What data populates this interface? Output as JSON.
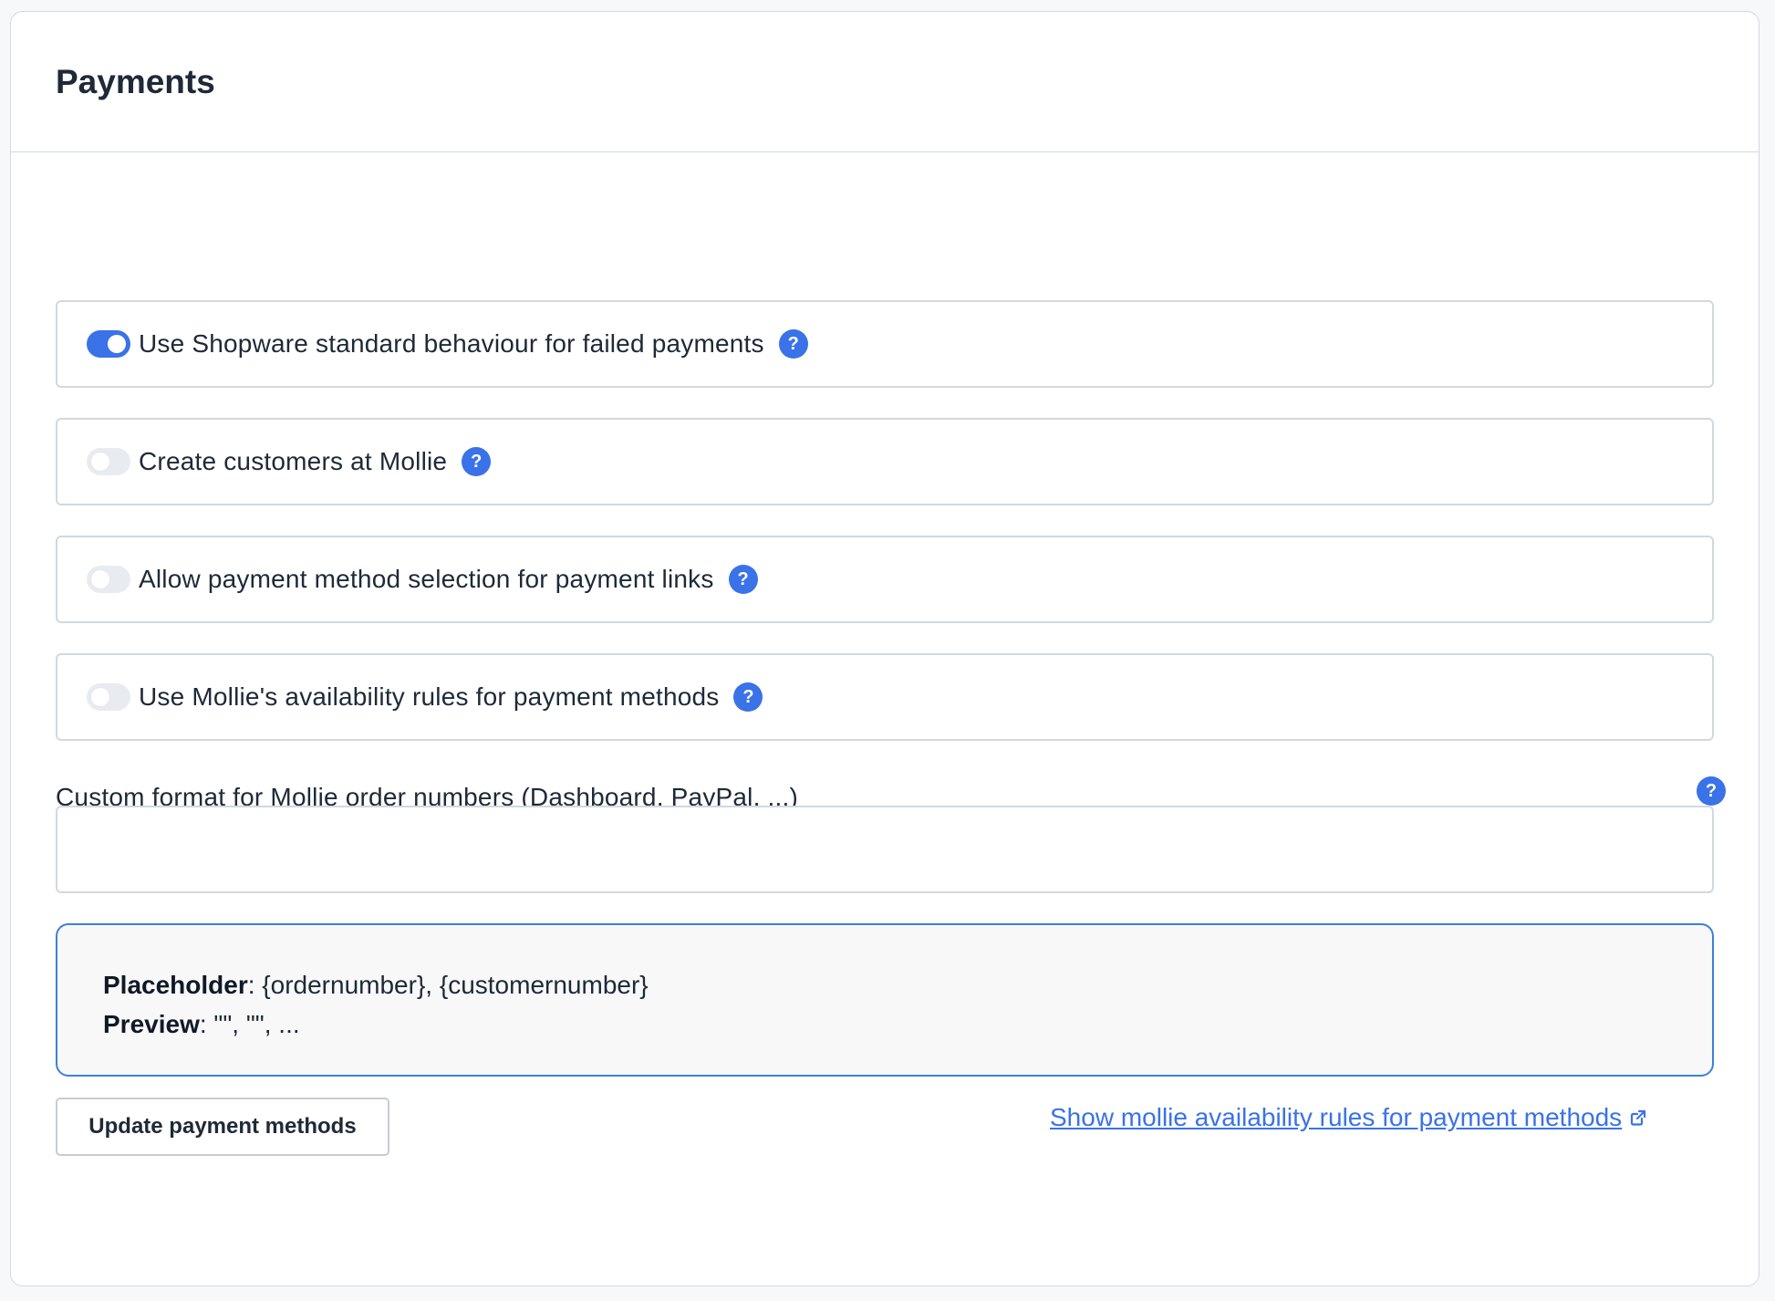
{
  "card": {
    "title": "Payments"
  },
  "switches": [
    {
      "label": "Use Shopware standard behaviour for failed payments",
      "checked": true
    },
    {
      "label": "Create customers at Mollie",
      "checked": false
    },
    {
      "label": "Allow payment method selection for payment links",
      "checked": false
    },
    {
      "label": "Use Mollie's availability rules for payment methods",
      "checked": false
    }
  ],
  "help_glyph": "?",
  "order_format": {
    "label": "Custom format for Mollie order numbers (Dashboard, PayPal, ...)",
    "value": "",
    "placeholder": ""
  },
  "info": {
    "placeholder_label": "Placeholder",
    "placeholder_value": ": {ordernumber}, {customernumber}",
    "preview_label": "Preview",
    "preview_value": ": \"\", \"\", ..."
  },
  "actions": {
    "update_button": "Update payment methods",
    "rules_link": "Show mollie availability rules for payment methods"
  },
  "colors": {
    "accent": "#3a72e8",
    "info_border": "#3a82d8",
    "border": "#d1d9e0"
  },
  "icons": {
    "help": "help-circle-icon",
    "external": "external-link-icon"
  }
}
